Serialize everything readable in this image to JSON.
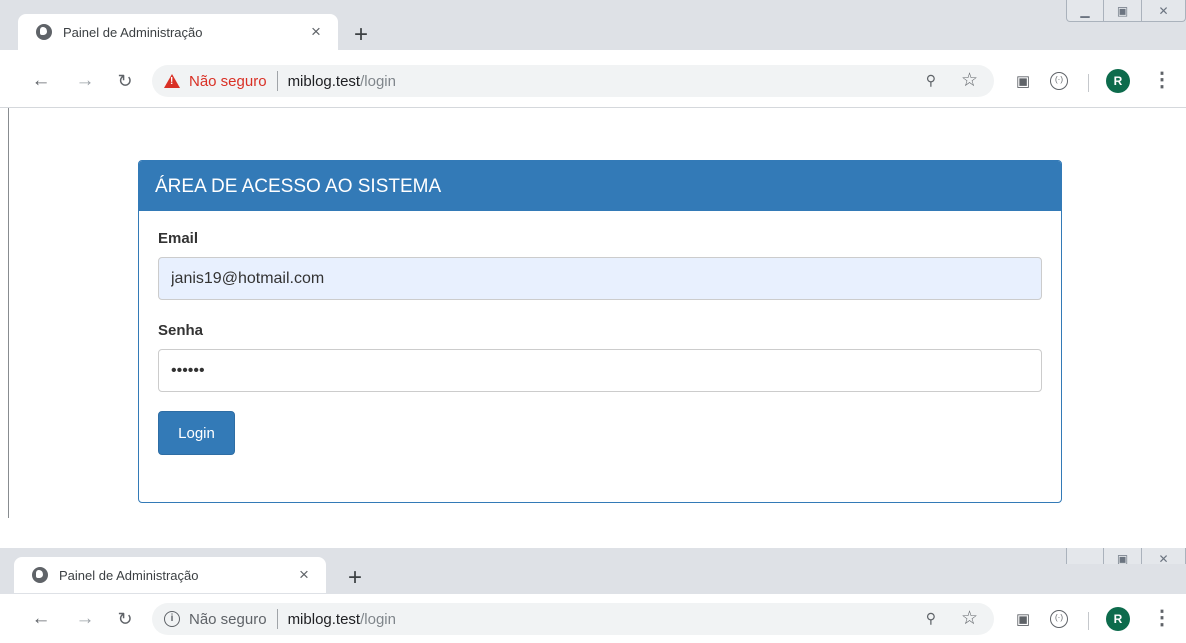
{
  "browser_primary": {
    "tab_title": "Painel de Administração",
    "tab_close": "×",
    "new_tab": "+",
    "security_label": "Não seguro",
    "url_host": "miblog.test",
    "url_path": "/login",
    "avatar_letter": "R"
  },
  "browser_secondary": {
    "tab_title": "Painel de Administração",
    "tab_close": "×",
    "new_tab": "+",
    "security_label": "Não seguro",
    "url_host": "miblog.test",
    "url_path": "/login",
    "avatar_letter": "R"
  },
  "login_panel": {
    "heading": "ÁREA DE ACESSO AO SISTEMA",
    "email_label": "Email",
    "email_value": "janis19@hotmail.com",
    "password_label": "Senha",
    "password_value": "••••••",
    "login_button": "Login"
  },
  "colors": {
    "primary": "#337ab7",
    "insecure_warning": "#d93025",
    "autofill_bg": "#e8f0fe",
    "avatar": "#0d6b4c"
  }
}
